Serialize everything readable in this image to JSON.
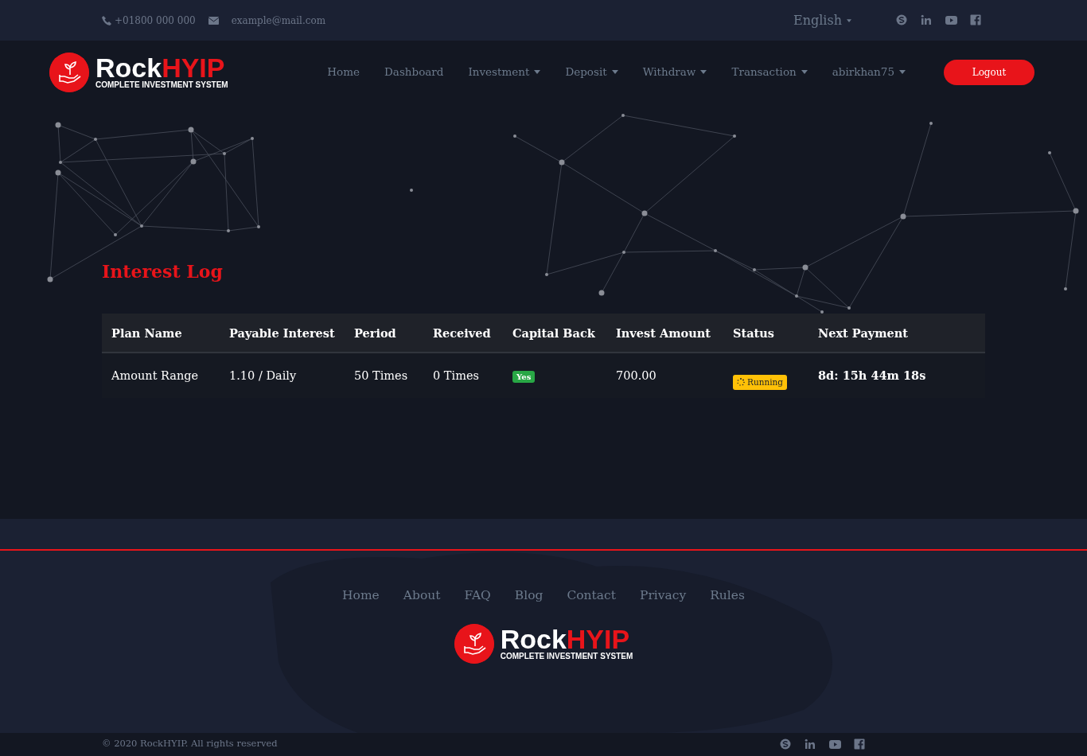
{
  "topbar": {
    "phone": "+01800 000 000",
    "email": "example@mail.com",
    "language": "English"
  },
  "header_brand": {
    "word_1": "Rock",
    "word_2": "HYIP",
    "tagline": "COMPLETE INVESTMENT SYSTEM"
  },
  "nav": {
    "items": [
      {
        "label": "Home",
        "dropdown": false
      },
      {
        "label": "Dashboard",
        "dropdown": false
      },
      {
        "label": "Investment",
        "dropdown": true
      },
      {
        "label": "Deposit",
        "dropdown": true
      },
      {
        "label": "Withdraw",
        "dropdown": true
      },
      {
        "label": "Transaction",
        "dropdown": true
      },
      {
        "label": "abirkhan75",
        "dropdown": true
      }
    ],
    "logout": "Logout"
  },
  "page_title": "Interest Log",
  "table": {
    "columns": [
      "Plan Name",
      "Payable Interest",
      "Period",
      "Received",
      "Capital Back",
      "Invest Amount",
      "Status",
      "Next Payment"
    ],
    "rows": [
      {
        "plan_name": "Amount Range",
        "payable_interest": "1.10 / Daily",
        "period": "50 Times",
        "received": "0 Times",
        "capital_back": "Yes",
        "invest_amount": "700.00",
        "status": "Running",
        "next_payment": "8d: 15h 44m 18s"
      }
    ]
  },
  "footer": {
    "brand": {
      "word_1": "Rock",
      "word_2": "HYIP",
      "tagline": "COMPLETE INVESTMENT SYSTEM"
    },
    "links": [
      "Home",
      "About",
      "FAQ",
      "Blog",
      "Contact",
      "Privacy",
      "Rules"
    ],
    "copyright": "© 2020 RockHYIP. All rights reserved"
  }
}
